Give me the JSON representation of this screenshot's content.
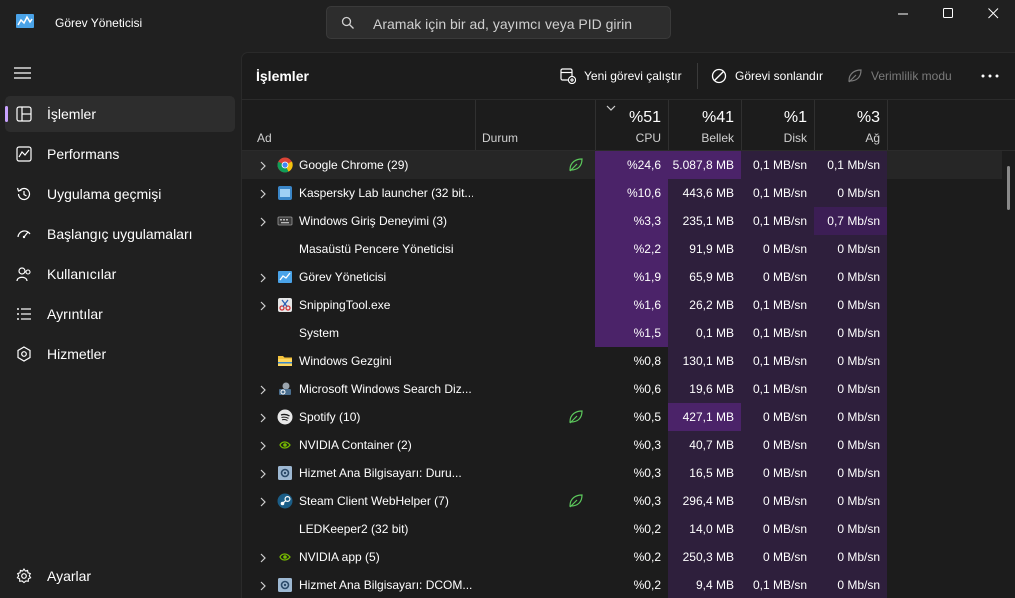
{
  "window": {
    "title": "Görev Yöneticisi",
    "search_placeholder": "Aramak için bir ad, yayımcı veya PID girin"
  },
  "nav": {
    "items": [
      {
        "label": "İşlemler",
        "icon": "processes-icon",
        "active": true
      },
      {
        "label": "Performans",
        "icon": "performance-icon"
      },
      {
        "label": "Uygulama geçmişi",
        "icon": "app-history-icon"
      },
      {
        "label": "Başlangıç uygulamaları",
        "icon": "startup-apps-icon"
      },
      {
        "label": "Kullanıcılar",
        "icon": "users-icon"
      },
      {
        "label": "Ayrıntılar",
        "icon": "details-icon"
      },
      {
        "label": "Hizmetler",
        "icon": "services-icon"
      }
    ],
    "settings_label": "Ayarlar"
  },
  "toolbar": {
    "page_title": "İşlemler",
    "new_task_label": "Yeni görevi çalıştır",
    "end_task_label": "Görevi sonlandır",
    "efficiency_label": "Verimlilik modu"
  },
  "table": {
    "headers": {
      "name": "Ad",
      "status": "Durum",
      "cpu_pct": "%51",
      "cpu_label": "CPU",
      "mem_pct": "%41",
      "mem_label": "Bellek",
      "disk_pct": "%1",
      "disk_label": "Disk",
      "net_pct": "%3",
      "net_label": "Ağ"
    },
    "rows": [
      {
        "name": "Google Chrome (29)",
        "icon": "chrome-icon",
        "expandable": true,
        "eco": true,
        "cpu": "%24,6",
        "mem": "5.087,8 MB",
        "disk": "0,1 MB/sn",
        "net": "0,1 Mb/sn"
      },
      {
        "name": "Kaspersky Lab launcher (32 bit...",
        "icon": "kaspersky-icon",
        "expandable": true,
        "eco": false,
        "cpu": "%10,6",
        "mem": "443,6 MB",
        "disk": "0,1 MB/sn",
        "net": "0 Mb/sn"
      },
      {
        "name": "Windows Giriş Deneyimi (3)",
        "icon": "keyboard-icon",
        "expandable": true,
        "eco": false,
        "cpu": "%3,3",
        "mem": "235,1 MB",
        "disk": "0,1 MB/sn",
        "net": "0,7 Mb/sn"
      },
      {
        "name": "Masaüstü Pencere Yöneticisi",
        "icon": "window-manager-icon",
        "expandable": false,
        "eco": false,
        "cpu": "%2,2",
        "mem": "91,9 MB",
        "disk": "0 MB/sn",
        "net": "0 Mb/sn"
      },
      {
        "name": "Görev Yöneticisi",
        "icon": "task-manager-icon",
        "expandable": true,
        "eco": false,
        "cpu": "%1,9",
        "mem": "65,9 MB",
        "disk": "0 MB/sn",
        "net": "0 Mb/sn"
      },
      {
        "name": "SnippingTool.exe",
        "icon": "snipping-tool-icon",
        "expandable": true,
        "eco": false,
        "cpu": "%1,6",
        "mem": "26,2 MB",
        "disk": "0,1 MB/sn",
        "net": "0 Mb/sn"
      },
      {
        "name": "System",
        "icon": "system-icon",
        "expandable": false,
        "eco": false,
        "cpu": "%1,5",
        "mem": "0,1 MB",
        "disk": "0,1 MB/sn",
        "net": "0 Mb/sn"
      },
      {
        "name": "Windows Gezgini",
        "icon": "folder-icon",
        "expandable": false,
        "eco": false,
        "cpu": "%0,8",
        "mem": "130,1 MB",
        "disk": "0,1 MB/sn",
        "net": "0 Mb/sn"
      },
      {
        "name": "Microsoft Windows Search Diz...",
        "icon": "search-indexer-icon",
        "expandable": true,
        "eco": false,
        "cpu": "%0,6",
        "mem": "19,6 MB",
        "disk": "0,1 MB/sn",
        "net": "0 Mb/sn"
      },
      {
        "name": "Spotify (10)",
        "icon": "spotify-icon",
        "expandable": true,
        "eco": true,
        "cpu": "%0,5",
        "mem": "427,1 MB",
        "disk": "0 MB/sn",
        "net": "0 Mb/sn"
      },
      {
        "name": "NVIDIA Container (2)",
        "icon": "nvidia-icon",
        "expandable": true,
        "eco": false,
        "cpu": "%0,3",
        "mem": "40,7 MB",
        "disk": "0 MB/sn",
        "net": "0 Mb/sn"
      },
      {
        "name": "Hizmet Ana Bilgisayarı: Duru...",
        "icon": "service-host-icon",
        "expandable": true,
        "eco": false,
        "cpu": "%0,3",
        "mem": "16,5 MB",
        "disk": "0 MB/sn",
        "net": "0 Mb/sn"
      },
      {
        "name": "Steam Client WebHelper (7)",
        "icon": "steam-icon",
        "expandable": true,
        "eco": true,
        "cpu": "%0,3",
        "mem": "296,4 MB",
        "disk": "0 MB/sn",
        "net": "0 Mb/sn"
      },
      {
        "name": "LEDKeeper2 (32 bit)",
        "icon": "ledkeeper-icon",
        "expandable": false,
        "eco": false,
        "cpu": "%0,2",
        "mem": "14,0 MB",
        "disk": "0 MB/sn",
        "net": "0 Mb/sn"
      },
      {
        "name": "NVIDIA app (5)",
        "icon": "nvidia-icon",
        "expandable": true,
        "eco": false,
        "cpu": "%0,2",
        "mem": "250,3 MB",
        "disk": "0 MB/sn",
        "net": "0 Mb/sn"
      },
      {
        "name": "Hizmet Ana Bilgisayarı: DCOM...",
        "icon": "service-host-icon",
        "expandable": true,
        "eco": false,
        "cpu": "%0,2",
        "mem": "9,4 MB",
        "disk": "0,1 MB/sn",
        "net": "0 Mb/sn"
      }
    ]
  },
  "colors": {
    "accent": "#c8a2ff",
    "heat_high": "#4b2369",
    "heat_mid": "#3c1e55",
    "heat_low": "#2e1f3c",
    "background": "#202020"
  }
}
